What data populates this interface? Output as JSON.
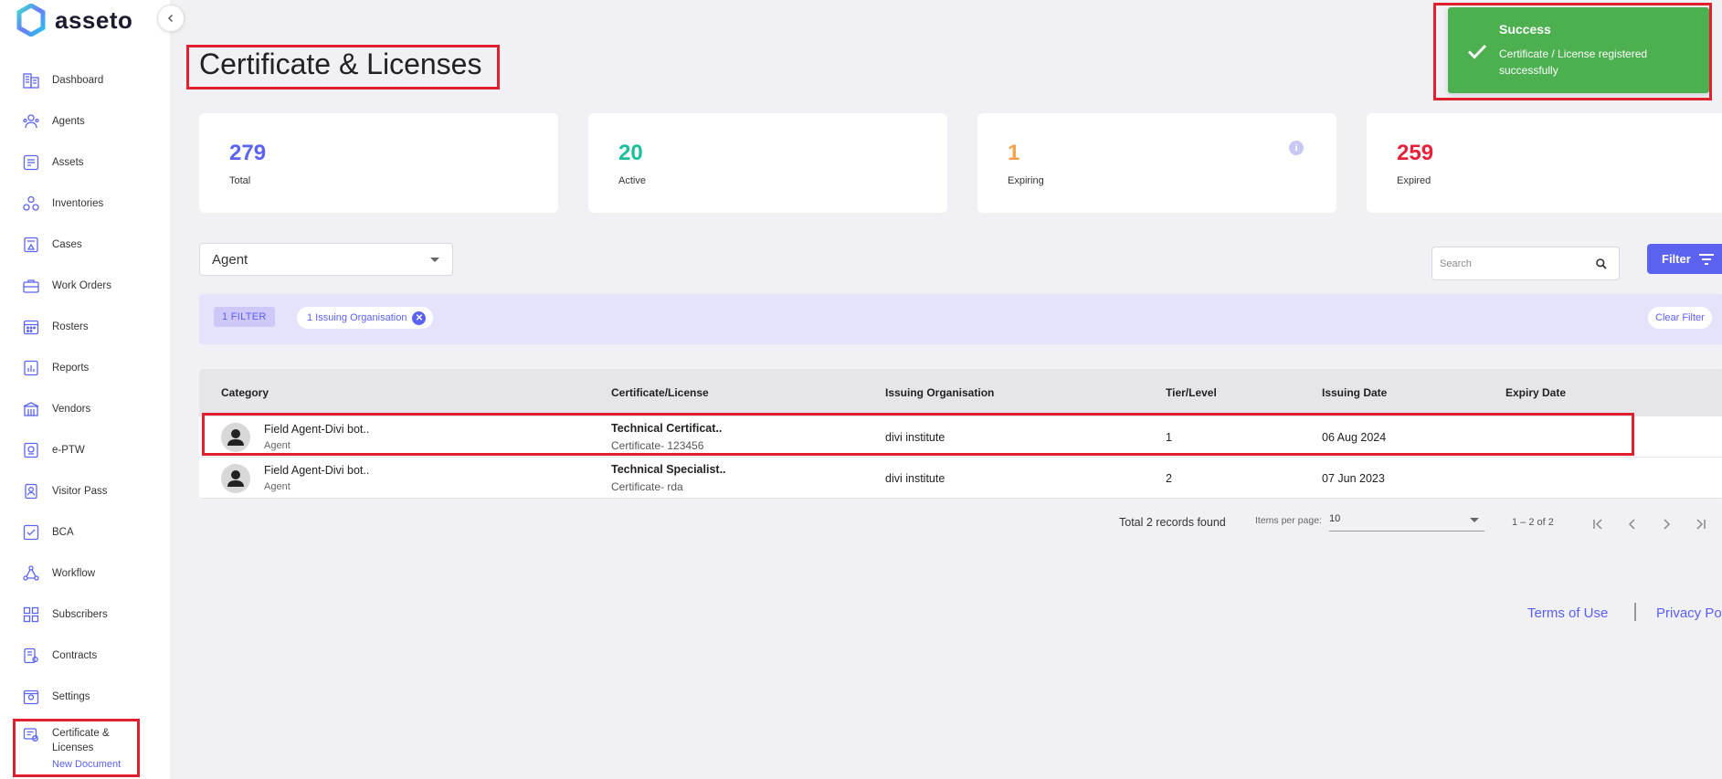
{
  "app": {
    "name": "asseto",
    "accent": "#5b63f0"
  },
  "sidebar": {
    "items": [
      {
        "label": "Dashboard",
        "icon": "dashboard-icon"
      },
      {
        "label": "Agents",
        "icon": "agents-icon"
      },
      {
        "label": "Assets",
        "icon": "assets-icon"
      },
      {
        "label": "Inventories",
        "icon": "inventories-icon"
      },
      {
        "label": "Cases",
        "icon": "cases-icon"
      },
      {
        "label": "Work Orders",
        "icon": "work-orders-icon"
      },
      {
        "label": "Rosters",
        "icon": "rosters-icon"
      },
      {
        "label": "Reports",
        "icon": "reports-icon"
      },
      {
        "label": "Vendors",
        "icon": "vendors-icon"
      },
      {
        "label": "e-PTW",
        "icon": "eptw-icon"
      },
      {
        "label": "Visitor Pass",
        "icon": "visitor-pass-icon"
      },
      {
        "label": "BCA",
        "icon": "bca-icon"
      },
      {
        "label": "Workflow",
        "icon": "workflow-icon"
      },
      {
        "label": "Subscribers",
        "icon": "subscribers-icon"
      },
      {
        "label": "Contracts",
        "icon": "contracts-icon"
      },
      {
        "label": "Settings",
        "icon": "settings-icon"
      }
    ],
    "active": {
      "label": "Certificate & Licenses",
      "sublink": "New Document",
      "icon": "certificate-icon"
    }
  },
  "page": {
    "title": "Certificate & Licenses"
  },
  "stats": [
    {
      "value": "279",
      "label": "Total",
      "color": "#5b63f0"
    },
    {
      "value": "20",
      "label": "Active",
      "color": "#1bbf9a"
    },
    {
      "value": "1",
      "label": "Expiring",
      "color": "#f5a04a"
    },
    {
      "value": "259",
      "label": "Expired",
      "color": "#e5223a"
    }
  ],
  "type_select": {
    "value": "Agent"
  },
  "search": {
    "placeholder": "Search"
  },
  "filter_button": {
    "label": "Filter"
  },
  "filter_bar": {
    "count_label": "1 FILTER",
    "chip_label": "1 Issuing Organisation",
    "clear_label": "Clear Filter"
  },
  "table": {
    "columns": [
      "Category",
      "Certificate/License",
      "Issuing Organisation",
      "Tier/Level",
      "Issuing Date",
      "Expiry Date"
    ],
    "rows": [
      {
        "name": "Field Agent-Divi bot..",
        "category": "Agent",
        "certificate": "Technical Certificat..",
        "cert_no": "Certificate- 123456",
        "org": "divi institute",
        "tier": "1",
        "issue_date": "06 Aug 2024",
        "expiry_date": ""
      },
      {
        "name": "Field Agent-Divi bot..",
        "category": "Agent",
        "certificate": "Technical Specialist..",
        "cert_no": "Certificate- rda",
        "org": "divi institute",
        "tier": "2",
        "issue_date": "07 Jun 2023",
        "expiry_date": ""
      }
    ]
  },
  "pagination": {
    "total_text": "Total 2 records found",
    "items_per_page_label": "Items per page:",
    "items_per_page": "10",
    "range": "1 – 2 of 2"
  },
  "footer": {
    "terms": "Terms of Use",
    "privacy": "Privacy Po"
  },
  "toast": {
    "title": "Success",
    "message": "Certificate / License registered successfully",
    "color": "#4caf50"
  }
}
